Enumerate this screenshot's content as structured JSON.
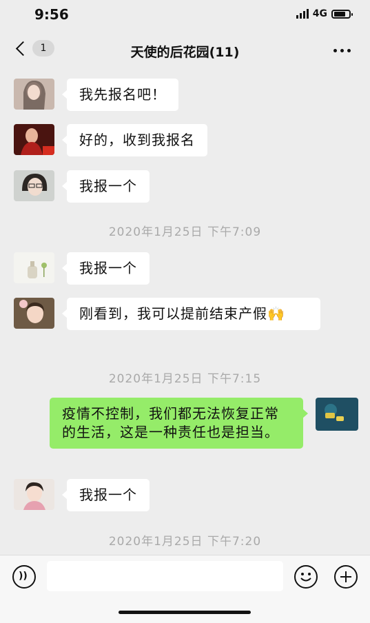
{
  "status_bar": {
    "time": "9:56",
    "network": "4G"
  },
  "nav": {
    "back_badge": "1",
    "title": "天使的后花园(11)"
  },
  "messages": [
    {
      "text": "我先报名吧！",
      "avatar": "avatar-woman-1"
    },
    {
      "text": "好的，收到我报名",
      "avatar": "avatar-woman-2"
    },
    {
      "text": "我报一个",
      "avatar": "avatar-woman-glasses"
    },
    {
      "text": "我报一个",
      "avatar": "avatar-bottle"
    },
    {
      "text": "刚看到，我可以提前结束产假🙌",
      "avatar": "avatar-girl-1"
    },
    {
      "text": "疫情不控制，我们都无法恢复正常的生活，这是一种责任也是担当。",
      "avatar": "avatar-self"
    },
    {
      "text": "我报一个",
      "avatar": "avatar-girl-2"
    }
  ],
  "timestamps": [
    "2020年1月25日 下午7:09",
    "2020年1月25日 下午7:15",
    "2020年1月25日 下午7:20"
  ],
  "input_bar": {
    "voice_icon": "voice-icon",
    "emoji_icon": "emoji-icon",
    "plus_icon": "plus-icon"
  },
  "colors": {
    "self_bubble": "#95ec69",
    "other_bubble": "#ffffff",
    "background": "#ededed"
  }
}
